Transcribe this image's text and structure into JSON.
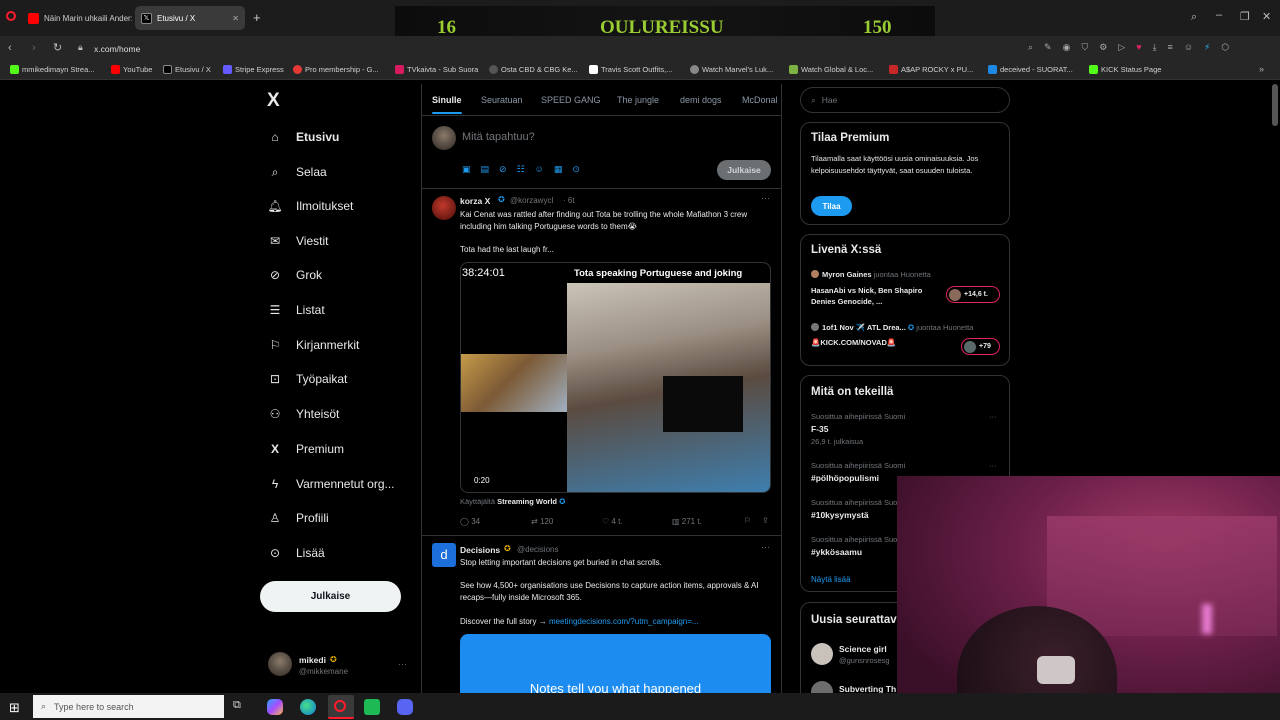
{
  "browser": {
    "tabs": [
      {
        "title": "Näin Marin uhkaili Ander:",
        "active": false
      },
      {
        "title": "Etusivu / X",
        "active": true
      }
    ],
    "new_tab": "+",
    "address": "x.com/home",
    "bookmarks": [
      "mmikedimayn Strea...",
      "YouTube",
      "Etusivu / X",
      "Stripe Express",
      "Pro membership - G...",
      "TVkaivta - Sub Suora",
      "Osta CBD & CBG Ke...",
      "Travis Scott Outfits,...",
      "Watch Marvel's Luk...",
      "Watch Global & Loc...",
      "A$AP ROCKY x PU...",
      "deceived - SUORAT...",
      "KICK Status Page"
    ]
  },
  "stream_overlay": {
    "left_number": "16",
    "title": "OULUREISSU",
    "right_number": "150"
  },
  "x_nav": {
    "logo": "X",
    "items": [
      {
        "label": "Etusivu",
        "icon": "home-icon"
      },
      {
        "label": "Selaa",
        "icon": "search-icon"
      },
      {
        "label": "Ilmoitukset",
        "icon": "bell-icon"
      },
      {
        "label": "Viestit",
        "icon": "mail-icon"
      },
      {
        "label": "Grok",
        "icon": "grok-icon"
      },
      {
        "label": "Listat",
        "icon": "list-icon"
      },
      {
        "label": "Kirjanmerkit",
        "icon": "bookmark-icon"
      },
      {
        "label": "Työpaikat",
        "icon": "briefcase-icon"
      },
      {
        "label": "Yhteisöt",
        "icon": "people-icon"
      },
      {
        "label": "Premium",
        "icon": "x-icon"
      },
      {
        "label": "Varmennetut org...",
        "icon": "lightning-icon"
      },
      {
        "label": "Profiili",
        "icon": "person-icon"
      },
      {
        "label": "Lisää",
        "icon": "more-circle-icon"
      }
    ],
    "post_button": "Julkaise",
    "account": {
      "name": "mikedi",
      "handle": "@mikkemane"
    }
  },
  "feed": {
    "tabs": [
      "Sinulle",
      "Seuratuan",
      "SPEED GANG",
      "The jungle",
      "demi dogs",
      "McDonal"
    ],
    "composer": {
      "placeholder": "Mitä tapahtuu?",
      "post_label": "Julkaise"
    },
    "tweet1": {
      "name": "korza X",
      "handle": "@korzawycl",
      "time": "· 6t",
      "text": "Kai Cenat was rattled after finding out Tota be trolling the whole Mafiathon 3 crew including him talking Portuguese words to them😭",
      "text2": "Tota had the last laugh fr...",
      "video_timer": "38:24:01",
      "video_caption": "Tota speaking Portuguese and joking",
      "video_time": "0:20",
      "source_prefix": "Käyttäjältä",
      "source": "Streaming World",
      "stats": {
        "replies": "34",
        "reposts": "120",
        "likes": "4 t.",
        "views": "271 t."
      }
    },
    "tweet2": {
      "name": "Decisions",
      "handle": "@decisions",
      "line1": "Stop letting important decisions get buried in chat scrolls.",
      "line2": "See how 4,500+ organisations use Decisions to capture action items, approvals & AI recaps—fully inside Microsoft 365.",
      "link_prefix": "Discover the full story →",
      "link": "meetingdecisions.com/?utm_campaign=...",
      "banner": "Notes tell you what happened"
    }
  },
  "right": {
    "search_placeholder": "Hae",
    "premium": {
      "title": "Tilaa Premium",
      "body": "Tilaamalla saat käyttöösi uusia ominaisuuksia. Jos kelpoisuusehdot täyttyvät, saat osuuden tuloista.",
      "button": "Tilaa"
    },
    "live": {
      "title": "Livenä X:ssä",
      "items": [
        {
          "host": "Myron Gaines",
          "status": "juontaa Huonetta",
          "title": "HasanAbi vs Nick, Ben Shapiro Denies Genocide, ...",
          "count": "+14,6 t."
        },
        {
          "host": "1of1 Nov ✈️ ATL Drea...",
          "status": "juontaa Huonetta",
          "title": "🚨KICK.COM/NOVAD🚨",
          "count": "+79"
        }
      ]
    },
    "trends": {
      "title": "Mitä on tekeillä",
      "items": [
        {
          "context": "Suosittua aihepiirissä Suomi",
          "name": "F-35",
          "count": "26,9 t. julkaisua"
        },
        {
          "context": "Suosittua aihepiirissä Suomi",
          "name": "#pölhöpopulismi",
          "count": ""
        },
        {
          "context": "Suosittua aihepiirissä Suomi",
          "name": "#10kysymystä",
          "count": ""
        },
        {
          "context": "Suosittua aihepiirissä Suomi",
          "name": "#ykkösaamu",
          "count": ""
        }
      ],
      "show_more": "Näytä lisää"
    },
    "follow": {
      "title": "Uusia seurattav",
      "items": [
        {
          "name": "Science girl",
          "handle": "@gunsnrosesg"
        },
        {
          "name": "Subverting Th",
          "handle": ""
        }
      ]
    }
  },
  "taskbar": {
    "search_placeholder": "Type here to search"
  },
  "colors": {
    "accent": "#1d9bf0",
    "overlay_text": "#9acd32",
    "background": "#000000"
  }
}
